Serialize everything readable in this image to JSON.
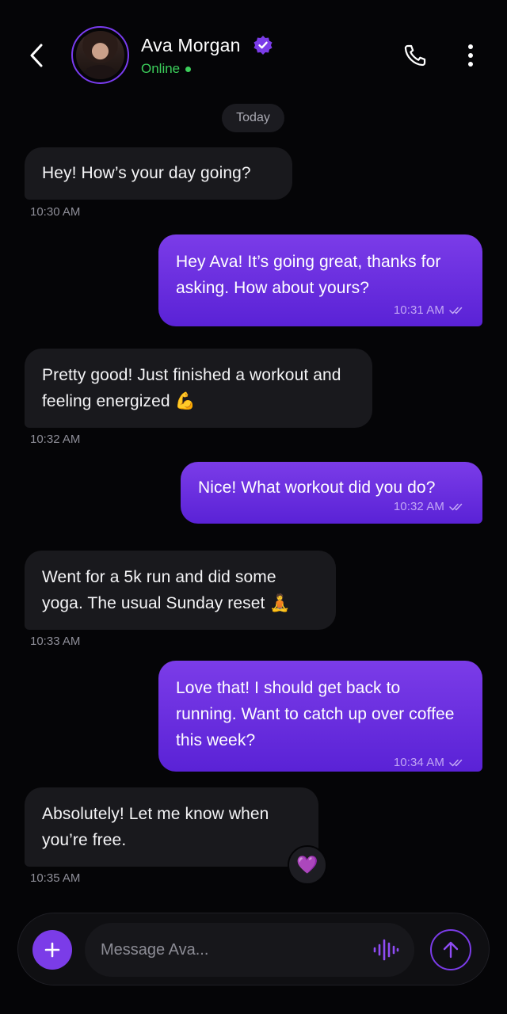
{
  "header": {
    "contact_name": "Ava Morgan",
    "status": "Online",
    "verified_icon": "verified-badge-icon",
    "accent_color": "#7b3ce8",
    "online_color": "#3ccf5b"
  },
  "date_divider": "Today",
  "messages": [
    {
      "direction": "incoming",
      "text": "Hey! How’s your day going?",
      "time": "10:30 AM"
    },
    {
      "direction": "outgoing",
      "text": "Hey Ava! It’s going great, thanks for asking. How about yours?",
      "time": "10:31 AM",
      "read": true
    },
    {
      "direction": "incoming",
      "text": "Pretty good! Just finished a workout and feeling energized 💪",
      "time": "10:32 AM"
    },
    {
      "direction": "outgoing",
      "text": "Nice! What workout did you do?",
      "time": "10:32 AM",
      "read": true
    },
    {
      "direction": "incoming",
      "text": "Went for a 5k run and did some yoga. The usual Sunday reset 🧘",
      "time": "10:33 AM"
    },
    {
      "direction": "outgoing",
      "text": "Love that! I should get back to running. Want to catch up over coffee this week?",
      "time": "10:34 AM",
      "read": true
    },
    {
      "direction": "incoming",
      "text": "Absolutely! Let me know when you’re free.",
      "time": "10:35 AM",
      "reaction": "💜"
    }
  ],
  "composer": {
    "placeholder": "Message Ava..."
  }
}
